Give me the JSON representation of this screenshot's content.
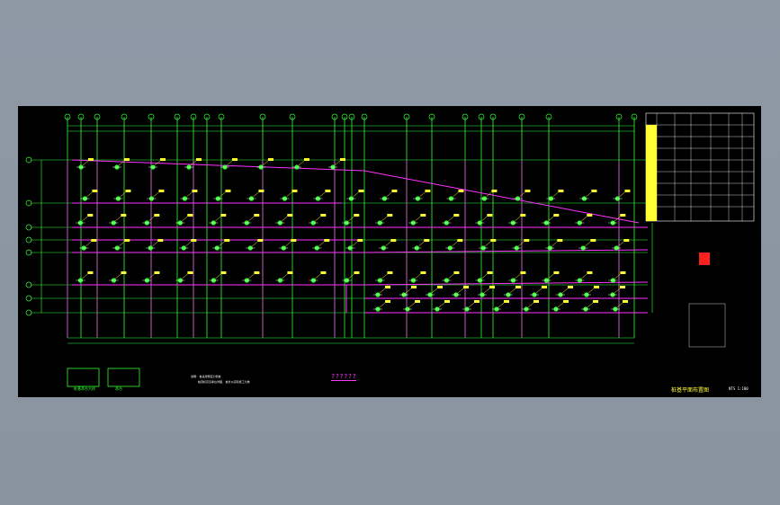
{
  "drawing": {
    "title": "??????",
    "plan_label": "桩基平面布置图",
    "scale": "NTS 1:100",
    "note_1": "说明: 桩采用预应力管桩",
    "note_2": "桩顶标高见承台详图, 桩长以实际施工为准",
    "detail_1": "桩基承台大样",
    "detail_2": "承台"
  },
  "colors": {
    "background": "#000000",
    "axis": "#33ff33",
    "beam": "#ff33ff",
    "pile": "#ffff33",
    "text": "#ffffff"
  }
}
